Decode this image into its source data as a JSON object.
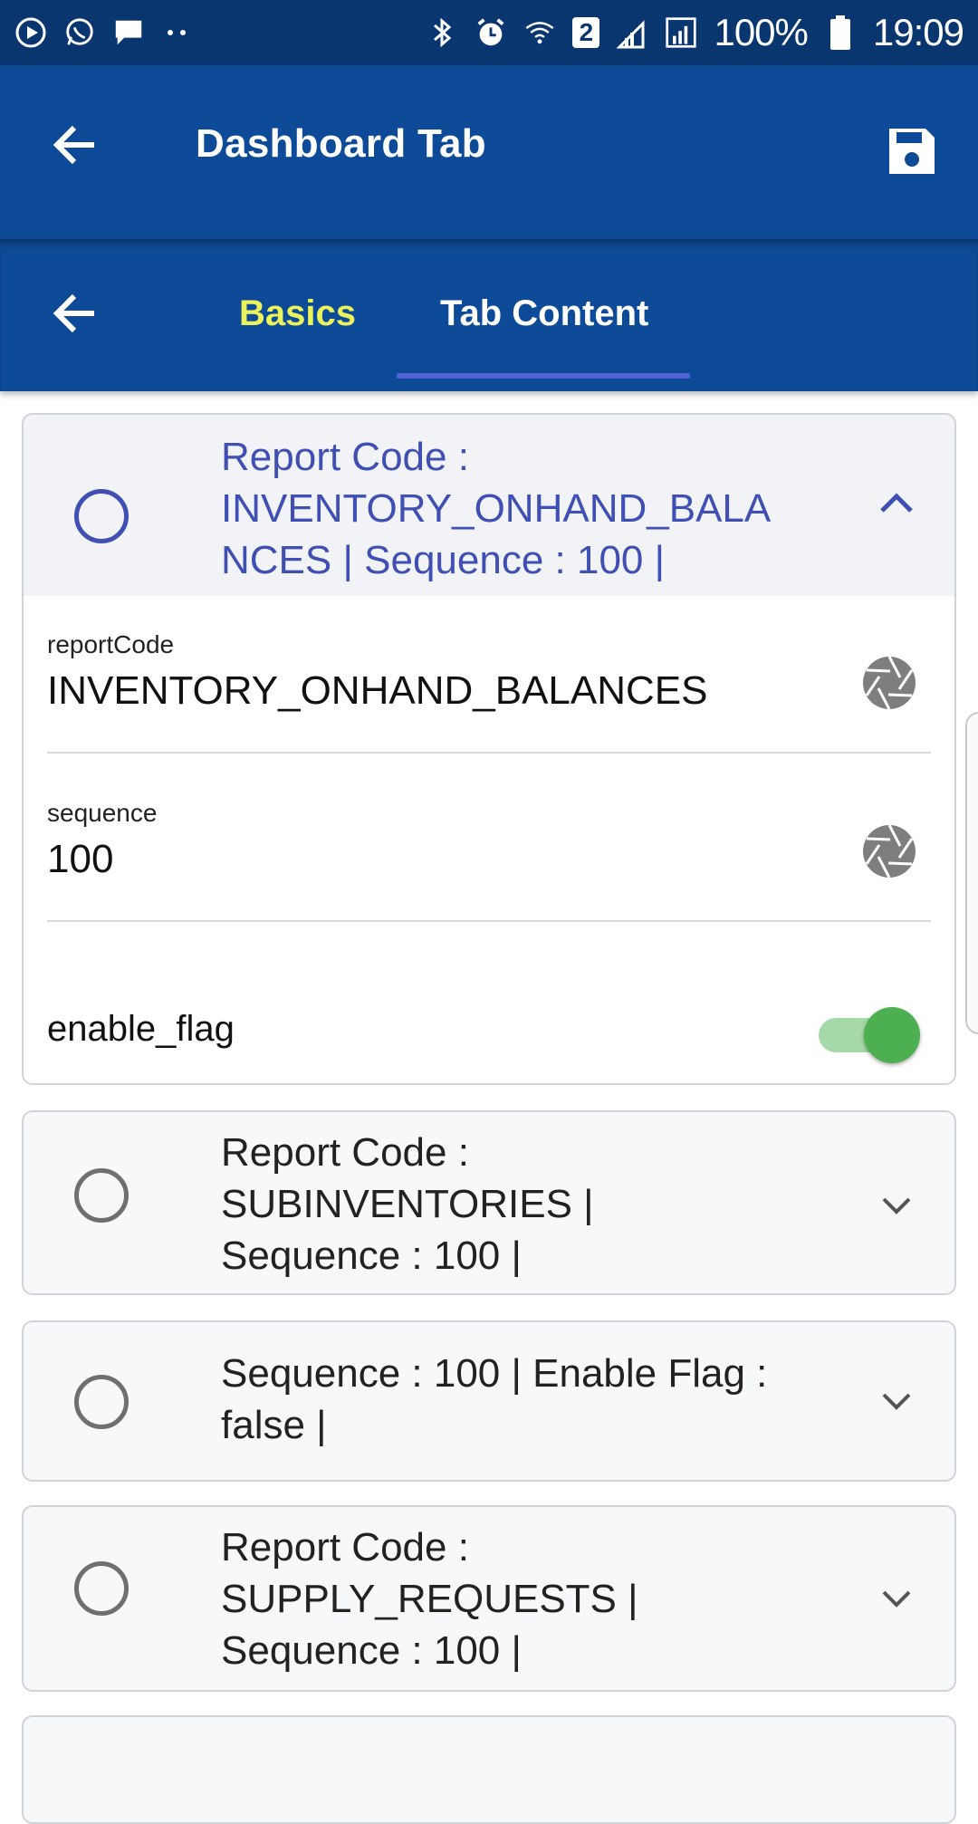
{
  "status_bar": {
    "battery": "100%",
    "time": "19:09",
    "sim_badge": "2",
    "icons": [
      "media-icon",
      "whatsapp-icon",
      "message-icon",
      "more-notifications-icon",
      "bluetooth-icon",
      "alarm-icon",
      "wifi-icon",
      "signal-roaming-icon",
      "signal-icon",
      "battery-icon"
    ]
  },
  "app_bar": {
    "title": "Dashboard Tab",
    "back_icon": "arrow-back-icon",
    "save_icon": "save-icon"
  },
  "tabs": {
    "back_icon": "arrow-back-icon",
    "items": [
      {
        "label": "Basics",
        "color": "#ecf35a"
      },
      {
        "label": "Tab Content",
        "active": true
      }
    ],
    "accent": "#4f62d6"
  },
  "cards": [
    {
      "title": "Report Code :\nINVENTORY_ONHAND_BALA\nNCES | Sequence : 100 |",
      "expanded": true,
      "fields": [
        {
          "label": "reportCode",
          "value": "INVENTORY_ONHAND_BALANCES"
        },
        {
          "label": "sequence",
          "value": "100"
        }
      ],
      "toggle": {
        "label": "enable_flag",
        "on": true
      }
    },
    {
      "title": "Report Code :\nSUBINVENTORIES |\nSequence : 100 |",
      "expanded": false
    },
    {
      "title": "Sequence : 100 | Enable Flag :\nfalse |",
      "expanded": false
    },
    {
      "title": "Report Code :\nSUPPLY_REQUESTS |\nSequence : 100 |",
      "expanded": false
    }
  ],
  "colors": {
    "status_bar": "#0a3670",
    "app_bar": "#0d4a97",
    "expanded_title": "#3f4fb3",
    "toggle_on": "#4caf50"
  }
}
